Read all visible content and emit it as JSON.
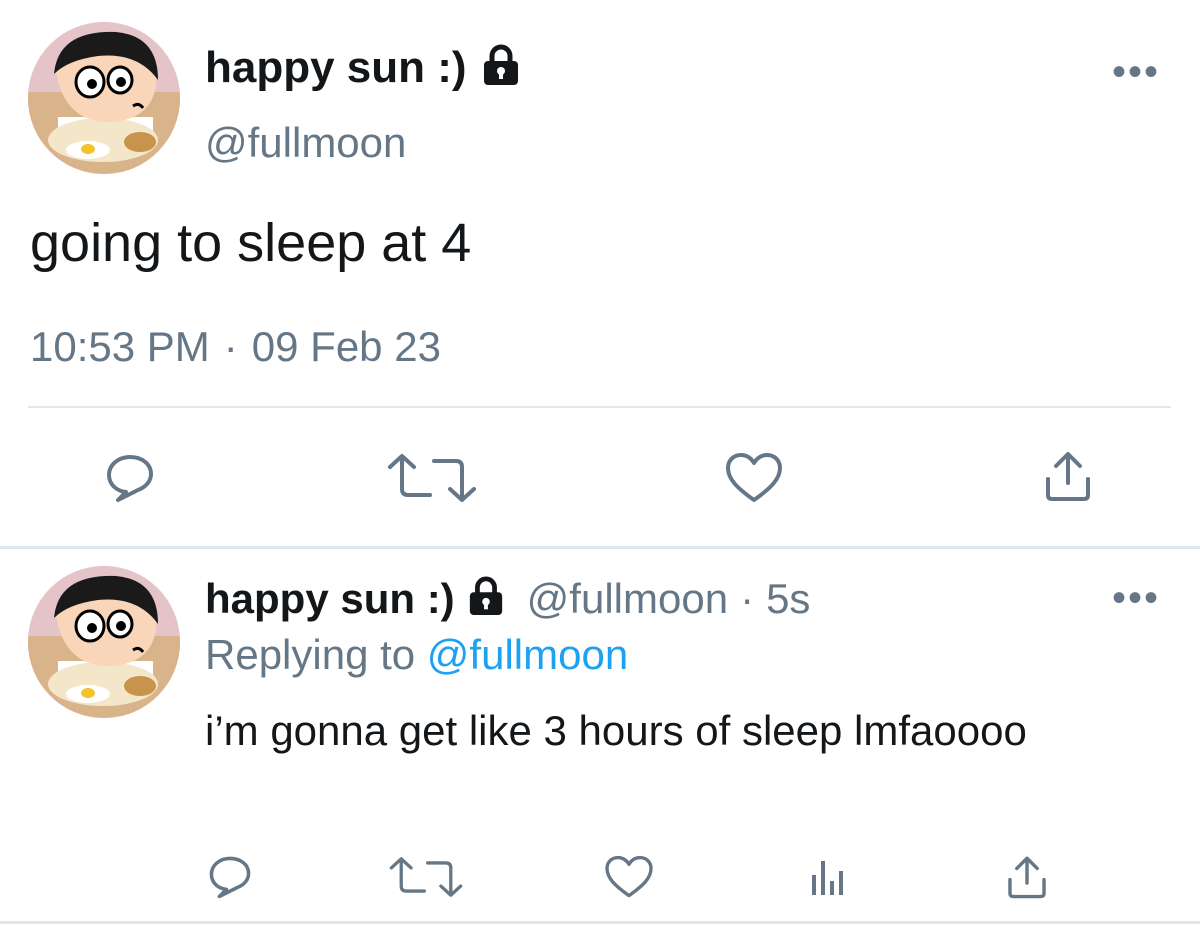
{
  "main_tweet": {
    "display_name": "happy sun :)",
    "locked_icon": "lock-icon",
    "handle": "@fullmoon",
    "text": "going to sleep at 4",
    "time": "10:53 PM",
    "separator": "·",
    "date": "09 Feb 23",
    "more_label": "•••",
    "actions": [
      "reply-icon",
      "retweet-icon",
      "like-icon",
      "share-icon"
    ]
  },
  "reply_tweet": {
    "display_name": "happy sun :)",
    "locked_icon": "lock-icon",
    "handle": "@fullmoon",
    "dot": "·",
    "age": "5s",
    "replying_prefix": "Replying to",
    "replying_handle": "@fullmoon",
    "text": "i’m gonna get like 3 hours of sleep lmfaoooo",
    "more_label": "•••",
    "actions": [
      "reply-icon",
      "retweet-icon",
      "like-icon",
      "analytics-icon",
      "share-icon"
    ]
  },
  "colors": {
    "text": "#14171a",
    "muted": "#657786",
    "link": "#1da1f2",
    "divider": "#e1e8ed"
  }
}
